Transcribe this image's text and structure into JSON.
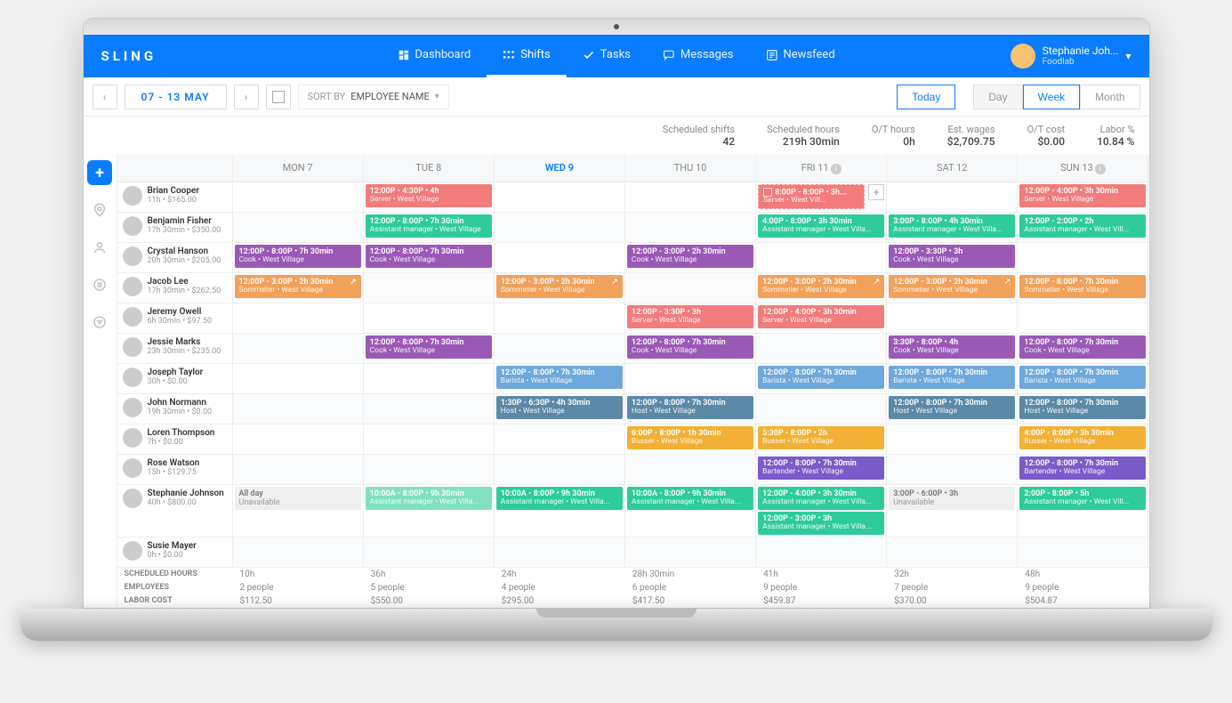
{
  "brand": "SLING",
  "nav": [
    {
      "label": "Dashboard",
      "icon": "dashboard"
    },
    {
      "label": "Shifts",
      "icon": "grid",
      "active": true
    },
    {
      "label": "Tasks",
      "icon": "check"
    },
    {
      "label": "Messages",
      "icon": "chat"
    },
    {
      "label": "Newsfeed",
      "icon": "feed"
    }
  ],
  "user": {
    "name": "Stephanie Joh...",
    "org": "Foodlab"
  },
  "toolbar": {
    "date_range": "07 - 13 MAY",
    "sort_label": "SORT BY",
    "sort_value": "EMPLOYEE NAME",
    "today": "Today",
    "segments": [
      "Day",
      "Week",
      "Month"
    ],
    "active_segment": "Week"
  },
  "stats": [
    {
      "label": "Scheduled shifts",
      "value": "42"
    },
    {
      "label": "Scheduled hours",
      "value": "219h 30min"
    },
    {
      "label": "O/T hours",
      "value": "0h"
    },
    {
      "label": "Est. wages",
      "value": "$2,709.75"
    },
    {
      "label": "O/T cost",
      "value": "$0.00"
    },
    {
      "label": "Labor %",
      "value": "10.84 %"
    }
  ],
  "days": [
    "MON 7",
    "TUE 8",
    "WED 9",
    "THU 10",
    "FRI 11",
    "SAT 12",
    "SUN 13"
  ],
  "today_index": 2,
  "info_days": [
    4,
    6
  ],
  "colors": {
    "server": "#f27b7b",
    "asst": "#2ecc9b",
    "cook": "#9b59b6",
    "somm": "#f1a15a",
    "barista": "#6fa8dc",
    "host": "#5b8aa8",
    "busser": "#f2b134",
    "bartender": "#7a5cc9",
    "unavail": "#efefef",
    "hostdark": "#4a7189"
  },
  "employees": [
    {
      "name": "Brian Cooper",
      "meta": "11h • $165.00",
      "shifts": {
        "1": [
          {
            "t": "12:00P - 4:30P • 4h",
            "s": "Server • West Village",
            "c": "server"
          }
        ],
        "4": [
          {
            "t": "8:00P - 8:00P • 3h...",
            "s": "Server • West Vill...",
            "c": "server",
            "dashed": true,
            "checkbox": true,
            "add": true
          }
        ],
        "6": [
          {
            "t": "12:00P - 4:00P • 3h 30min",
            "s": "Server • West Village",
            "c": "server"
          }
        ]
      }
    },
    {
      "name": "Benjamin Fisher",
      "meta": "17h 30min • $350.00",
      "shifts": {
        "1": [
          {
            "t": "12:00P - 8:00P • 7h 30min",
            "s": "Assistant manager • West Village",
            "c": "asst"
          }
        ],
        "4": [
          {
            "t": "4:00P - 8:00P • 3h 30min",
            "s": "Assistant manager • West Villa...",
            "c": "asst"
          }
        ],
        "5": [
          {
            "t": "3:00P - 8:00P • 4h 30min",
            "s": "Assistant manager • West Villa...",
            "c": "asst"
          }
        ],
        "6": [
          {
            "t": "12:00P - 2:00P • 2h",
            "s": "Assistant manager • West Vill...",
            "c": "asst"
          }
        ]
      }
    },
    {
      "name": "Crystal Hanson",
      "meta": "20h 30min • $205.00",
      "shifts": {
        "0": [
          {
            "t": "12:00P - 8:00P • 7h 30min",
            "s": "Cook • West Village",
            "c": "cook"
          }
        ],
        "1": [
          {
            "t": "12:00P - 8:00P • 7h 30min",
            "s": "Cook • West Village",
            "c": "cook"
          }
        ],
        "3": [
          {
            "t": "12:00P - 3:00P • 2h 30min",
            "s": "Cook • West Village",
            "c": "cook"
          }
        ],
        "5": [
          {
            "t": "12:00P - 3:30P • 3h",
            "s": "Cook • West Village",
            "c": "cook"
          }
        ]
      }
    },
    {
      "name": "Jacob Lee",
      "meta": "17h 30min • $262.50",
      "shifts": {
        "0": [
          {
            "t": "12:00P - 3:00P • 2h 30min",
            "s": "Sommelier • West Village",
            "c": "somm",
            "open": true
          }
        ],
        "2": [
          {
            "t": "12:00P - 3:00P • 2h 30min",
            "s": "Sommelier • West Village",
            "c": "somm",
            "open": true
          }
        ],
        "4": [
          {
            "t": "12:00P - 3:00P • 2h 30min",
            "s": "Sommelier • West Village",
            "c": "somm",
            "open": true
          }
        ],
        "5": [
          {
            "t": "12:00P - 3:00P • 2h 30min",
            "s": "Sommelier • West Village",
            "c": "somm",
            "open": true
          }
        ],
        "6": [
          {
            "t": "12:00P - 8:00P • 7h 30min",
            "s": "Sommelier • West Village",
            "c": "somm"
          }
        ]
      }
    },
    {
      "name": "Jeremy Owell",
      "meta": "6h 30min • $97.50",
      "shifts": {
        "3": [
          {
            "t": "12:00P - 3:30P • 3h",
            "s": "Server • West Village",
            "c": "server"
          }
        ],
        "4": [
          {
            "t": "12:00P - 4:00P • 3h 30min",
            "s": "Server • West Village",
            "c": "server"
          }
        ]
      }
    },
    {
      "name": "Jessie Marks",
      "meta": "23h 30min • $235.00",
      "shifts": {
        "1": [
          {
            "t": "12:00P - 8:00P • 7h 30min",
            "s": "Cook • West Village",
            "c": "cook"
          }
        ],
        "3": [
          {
            "t": "12:00P - 8:00P • 7h 30min",
            "s": "Cook • West Village",
            "c": "cook"
          }
        ],
        "5": [
          {
            "t": "3:30P - 8:00P • 4h",
            "s": "Cook • West Village",
            "c": "cook"
          }
        ],
        "6": [
          {
            "t": "12:00P - 8:00P • 7h 30min",
            "s": "Cook • West Village",
            "c": "cook"
          }
        ]
      }
    },
    {
      "name": "Joseph Taylor",
      "meta": "30h • $0.00",
      "shifts": {
        "2": [
          {
            "t": "12:00P - 8:00P • 7h 30min",
            "s": "Barista • West Village",
            "c": "barista"
          }
        ],
        "4": [
          {
            "t": "12:00P - 8:00P • 7h 30min",
            "s": "Barista • West Village",
            "c": "barista"
          }
        ],
        "5": [
          {
            "t": "12:00P - 8:00P • 7h 30min",
            "s": "Barista • West Village",
            "c": "barista"
          }
        ],
        "6": [
          {
            "t": "12:00P - 8:00P • 7h 30min",
            "s": "Barista • West Village",
            "c": "barista"
          }
        ]
      }
    },
    {
      "name": "John Normann",
      "meta": "19h 30min • $0.00",
      "shifts": {
        "2": [
          {
            "t": "1:30P - 6:30P • 4h 30min",
            "s": "Host • West Village",
            "c": "host"
          }
        ],
        "3": [
          {
            "t": "12:00P - 8:00P • 7h 30min",
            "s": "Host • West Village",
            "c": "host"
          }
        ],
        "5": [
          {
            "t": "12:00P - 8:00P • 7h 30min",
            "s": "Host • West Village",
            "c": "host"
          }
        ],
        "6": [
          {
            "t": "12:00P - 8:00P • 7h 30min",
            "s": "Host • West Village",
            "c": "host"
          }
        ]
      }
    },
    {
      "name": "Loren Thompson",
      "meta": "7h • $0.00",
      "shifts": {
        "3": [
          {
            "t": "6:00P - 8:00P • 1h 30min",
            "s": "Busser • West Village",
            "c": "busser"
          }
        ],
        "4": [
          {
            "t": "5:30P - 8:00P • 2h",
            "s": "Busser • West Village",
            "c": "busser"
          }
        ],
        "6": [
          {
            "t": "4:00P - 8:00P • 3h 30min",
            "s": "Busser • West Village",
            "c": "busser"
          }
        ]
      }
    },
    {
      "name": "Rose Watson",
      "meta": "15h • $129.75",
      "shifts": {
        "4": [
          {
            "t": "12:00P - 8:00P • 7h 30min",
            "s": "Bartender • West Village",
            "c": "bartender"
          }
        ],
        "6": [
          {
            "t": "12:00P - 8:00P • 7h 30min",
            "s": "Bartender • West Village",
            "c": "bartender"
          }
        ]
      }
    },
    {
      "name": "Stephanie Johnson",
      "meta": "40h • $800.00",
      "shifts": {
        "0": [
          {
            "t": "All day",
            "s": "Unavailable",
            "c": "unavail",
            "unavail": true
          }
        ],
        "1": [
          {
            "t": "10:00A - 8:00P • 9h 30min",
            "s": "Assistant manager • West Villa...",
            "c": "asst",
            "light": true
          }
        ],
        "2": [
          {
            "t": "10:00A - 8:00P • 9h 30min",
            "s": "Assistant manager • West Villa...",
            "c": "asst"
          }
        ],
        "3": [
          {
            "t": "10:00A - 8:00P • 9h 30min",
            "s": "Assistant manager • West Villa...",
            "c": "asst"
          }
        ],
        "4": [
          {
            "t": "12:00P - 4:00P • 3h 30min",
            "s": "Assistant manager • West Villa...",
            "c": "asst"
          },
          {
            "t": "12:00P - 3:00P • 3h",
            "s": "Assistant manager • West Villa...",
            "c": "asst"
          }
        ],
        "5": [
          {
            "t": "3:00P - 6:00P • 3h",
            "s": "Unavailable",
            "c": "unavail",
            "unavail": true
          }
        ],
        "6": [
          {
            "t": "2:00P - 8:00P • 5h",
            "s": "Assistant manager • West Vill...",
            "c": "asst"
          }
        ]
      }
    },
    {
      "name": "Susie Mayer",
      "meta": "0h • $0.00",
      "shifts": {}
    }
  ],
  "summary": {
    "rows": [
      {
        "label": "SCHEDULED HOURS",
        "vals": [
          "10h",
          "36h",
          "24h",
          "28h 30min",
          "41h",
          "32h",
          "48h"
        ]
      },
      {
        "label": "EMPLOYEES",
        "vals": [
          "2 people",
          "5 people",
          "4 people",
          "6 people",
          "9 people",
          "7 people",
          "9 people"
        ]
      },
      {
        "label": "LABOR COST",
        "vals": [
          "$112.50",
          "$550.00",
          "$295.00",
          "$417.50",
          "$459.87",
          "$370.00",
          "$504.87"
        ]
      }
    ]
  }
}
